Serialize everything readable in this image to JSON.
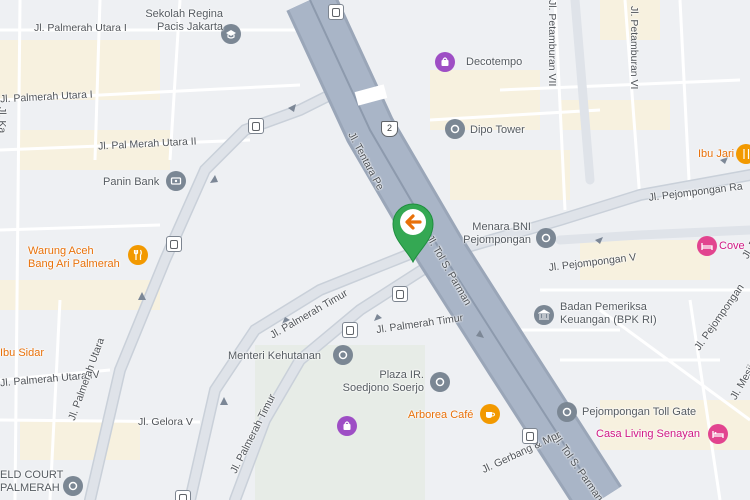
{
  "map": {
    "selected_pin": {
      "icon": "arrow-left-icon",
      "color": "#34a853"
    },
    "highway_shield": "2",
    "road_labels": [
      "Jl. Palmerah Utara I",
      "Jl. Palmerah Utara I",
      "Jl. Pal Merah Utara II",
      "Jl. Palmerah Utara IV",
      "Jl. Palmerah Utara",
      "Jl. Gelora V",
      "Jl. Tentara Pe",
      "Jl. Tol S. Parman",
      "Jl. Palmerah Timur",
      "Jl. Palmerah Timur",
      "Jl. Palmerah Timur",
      "Jl. Tol S. Parman",
      "Jl. Pejompongan Ra",
      "Jl. Pejompongan V",
      "Jl. Pejompongan",
      "Jl. Mesjid",
      "Jl. Petamburan VII",
      "Jl. Petamburan VI",
      "Jl. Ka",
      "Jl. Gerbang & Mpr",
      "Jl. Pl"
    ],
    "places": [
      {
        "name": "Sekolah Regina\nPacis Jakarta",
        "icon": "school-icon"
      },
      {
        "name": "Decotempo",
        "icon": "shopping-icon"
      },
      {
        "name": "Dipo Tower",
        "icon": "building-icon"
      },
      {
        "name": "Panin Bank",
        "icon": "bank-icon"
      },
      {
        "name": "Warung Aceh\nBang Ari Palmerah",
        "icon": "restaurant-icon"
      },
      {
        "name": "Menara BNI\nPejompongan",
        "icon": "building-icon"
      },
      {
        "name": "Badan Pemeriksa\nKeuangan (BPK RI)",
        "icon": "government-icon"
      },
      {
        "name": "Menteri Kehutanan",
        "icon": "building-icon"
      },
      {
        "name": "Plaza IR.\nSoedjono Soerjo",
        "icon": "building-icon"
      },
      {
        "name": "Arborea Café",
        "icon": "cafe-icon"
      },
      {
        "name": "Pejompongan Toll Gate",
        "icon": "building-icon"
      },
      {
        "name": "Casa Living Senayan",
        "icon": "hotel-icon"
      },
      {
        "name": "Ibu Jari",
        "icon": "restaurant-icon"
      },
      {
        "name": "Cove",
        "icon": "hotel-icon"
      },
      {
        "name": "Ibu Sidar",
        "icon": "restaurant-icon"
      },
      {
        "name": "ELD COURT\nPALMERAH",
        "icon": "building-icon"
      }
    ]
  }
}
